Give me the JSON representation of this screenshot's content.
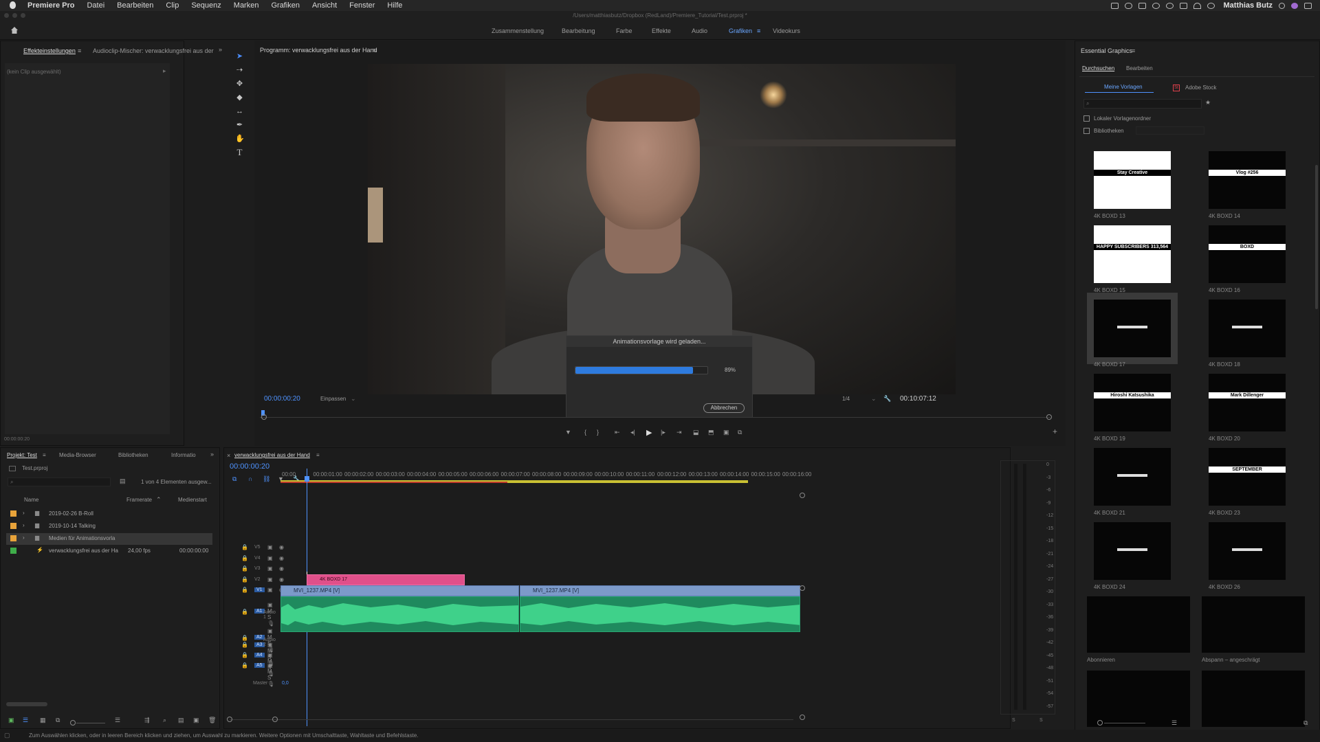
{
  "menubar": {
    "app": "Premiere Pro",
    "items": [
      "Datei",
      "Bearbeiten",
      "Clip",
      "Sequenz",
      "Marken",
      "Grafiken",
      "Ansicht",
      "Fenster",
      "Hilfe"
    ],
    "user": "Matthias Butz"
  },
  "title_bar": "/Users/matthiasbutz/Dropbox (RedLand)/Premiere_Tutorial/Test.prproj *",
  "workspaces": {
    "tabs": [
      "Zusammenstellung",
      "Bearbeitung",
      "Farbe",
      "Effekte",
      "Audio",
      "Grafiken",
      "Videokurs"
    ],
    "active": "Grafiken"
  },
  "effects_panel": {
    "tab_effects": "Effekteinstellungen",
    "tab_audio_mixer": "Audioclip-Mischer: verwacklungsfrei aus der",
    "no_clip": "(kein Clip ausgewählt)",
    "timecode": "00:00:00:20"
  },
  "program_monitor": {
    "title": "Programm: verwacklungsfrei aus der Hand",
    "timecode": "00:00:00:20",
    "zoom": "Einpassen",
    "resolution": "1/4",
    "duration": "00:10:07:12"
  },
  "dialog": {
    "title": "Animationsvorlage wird geladen...",
    "progress_percent": 89,
    "progress_label": "89%",
    "cancel": "Abbrechen"
  },
  "essential_graphics": {
    "title": "Essential Graphics",
    "tab_browse": "Durchsuchen",
    "tab_edit": "Bearbeiten",
    "my_templates": "Meine Vorlagen",
    "adobe_stock": "Adobe Stock",
    "local_folder": "Lokaler Vorlagenordner",
    "libraries": "Bibliotheken",
    "templates": [
      {
        "label": "4K BOXD 13",
        "style": "white",
        "text": "Stay Creative"
      },
      {
        "label": "4K BOXD 14",
        "style": "black",
        "text": "Vlog #256"
      },
      {
        "label": "4K BOXD 15",
        "style": "white",
        "text": "HAPPY SUBSCRIBERS 313,564"
      },
      {
        "label": "4K BOXD 16",
        "style": "black",
        "text": "BOXD"
      },
      {
        "label": "4K BOXD 17",
        "style": "black",
        "text": ""
      },
      {
        "label": "4K BOXD 18",
        "style": "black",
        "text": ""
      },
      {
        "label": "4K BOXD 19",
        "style": "black",
        "text": "Hiroshi Katsushika"
      },
      {
        "label": "4K BOXD 20",
        "style": "black",
        "text": "Mark Dillenger"
      },
      {
        "label": "4K BOXD 21",
        "style": "black",
        "text": ""
      },
      {
        "label": "4K BOXD 23",
        "style": "black",
        "text": "SEPTEMBER"
      },
      {
        "label": "4K BOXD 24",
        "style": "black",
        "text": ""
      },
      {
        "label": "4K BOXD 26",
        "style": "black",
        "text": ""
      },
      {
        "label": "Abonnieren",
        "style": "black",
        "text": ""
      },
      {
        "label": "Abspann – angeschrägt",
        "style": "black",
        "text": ""
      },
      {
        "label": "",
        "style": "black",
        "text": ""
      },
      {
        "label": "",
        "style": "black",
        "text": ""
      }
    ]
  },
  "project_panel": {
    "tab_project": "Projekt: Test",
    "tab_media": "Media-Browser",
    "tab_libraries": "Bibliotheken",
    "tab_info": "Informatio",
    "file": "Test.prproj",
    "count": "1 von 4 Elementen ausgew...",
    "col_name": "Name",
    "col_framerate": "Framerate",
    "col_start": "Medienstart",
    "items": [
      {
        "name": "2019-02-26 B-Roll",
        "rate": "",
        "start": "",
        "color": "#e8a33a"
      },
      {
        "name": "2019-10-14 Talking",
        "rate": "",
        "start": "",
        "color": "#e8a33a"
      },
      {
        "name": "Medien für Animationsvorla",
        "rate": "",
        "start": "",
        "color": "#e8a33a"
      },
      {
        "name": "verwacklungsfrei aus der Ha",
        "rate": "24,00 fps",
        "start": "00:00:00:00",
        "color": "#3fae4a"
      }
    ]
  },
  "timeline": {
    "tab": "verwacklungsfrei aus der Hand",
    "timecode": "00:00:00:20",
    "ruler": [
      "00:00",
      "00:00:01:00",
      "00:00:02:00",
      "00:00:03:00",
      "00:00:04:00",
      "00:00:05:00",
      "00:00:06:00",
      "00:00:07:00",
      "00:00:08:00",
      "00:00:09:00",
      "00:00:10:00",
      "00:00:11:00",
      "00:00:12:00",
      "00:00:13:00",
      "00:00:14:00",
      "00:00:15:00",
      "00:00:16:00"
    ],
    "video_tracks": [
      "V5",
      "V4",
      "V3",
      "V2",
      "V1"
    ],
    "audio_tracks": [
      "A1",
      "A2",
      "A3",
      "A4",
      "A5"
    ],
    "audio_names": [
      "Audio 1",
      "Audio 2"
    ],
    "master": "Master",
    "master_value": "0,0",
    "graphic_clip": "4K BOXD 17",
    "clip1": "MVI_1237.MP4 [V]",
    "clip2": "MVI_1237.MP4 [V]"
  },
  "meters": {
    "scale": [
      "0",
      "-3",
      "-6",
      "-9",
      "-12",
      "-15",
      "-18",
      "-21",
      "-24",
      "-27",
      "-30",
      "-33",
      "-36",
      "-39",
      "-42",
      "-45",
      "-48",
      "-51",
      "-54",
      "-57"
    ],
    "left": "S",
    "right": "S"
  },
  "status_bar": "Zum Auswählen klicken, oder in leeren Bereich klicken und ziehen, um Auswahl zu markieren. Weitere Optionen mit Umschalttaste, Wahltaste und Befehlstaste."
}
